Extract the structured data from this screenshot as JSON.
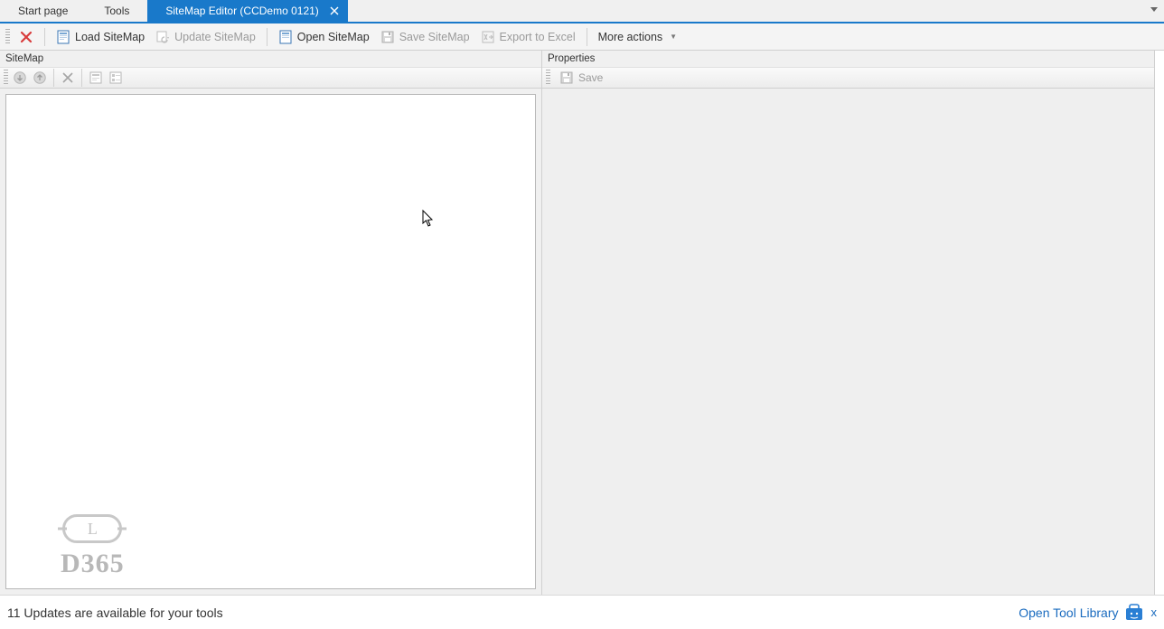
{
  "tabs": {
    "items": [
      {
        "label": "Start page",
        "active": false,
        "closable": false
      },
      {
        "label": "Tools",
        "active": false,
        "closable": false
      },
      {
        "label": "SiteMap Editor (CCDemo 0121)",
        "active": true,
        "closable": true
      }
    ]
  },
  "toolbar": {
    "close_label": "",
    "load_sitemap": "Load SiteMap",
    "update_sitemap": "Update SiteMap",
    "open_sitemap": "Open SiteMap",
    "save_sitemap": "Save SiteMap",
    "export_excel": "Export to Excel",
    "more_actions": "More actions"
  },
  "left": {
    "title": "SiteMap",
    "watermark_letter": "L",
    "watermark_text": "D365"
  },
  "right": {
    "title": "Properties",
    "save_label": "Save"
  },
  "statusbar": {
    "updates_text": "11 Updates are available for your tools",
    "library_link": "Open Tool Library",
    "close_label": "x"
  }
}
